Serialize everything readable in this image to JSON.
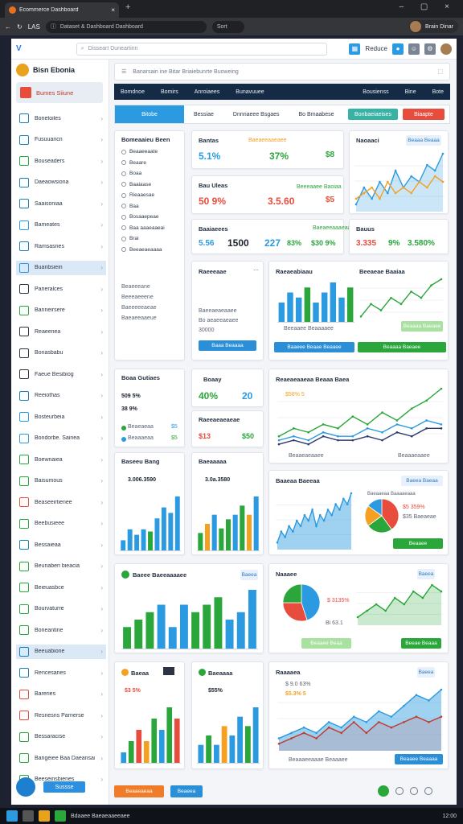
{
  "browser": {
    "tab_title": "Ecommerce Dashboard",
    "address": "Dataset & Dashboard Dashboard",
    "secondary_field": "Sort",
    "profile_name": "Brain Dinar",
    "back_label": "LAS"
  },
  "app": {
    "logo": "V",
    "search_placeholder": "Disseart Duneartinn",
    "top_right_label": "Reduce",
    "brand": "Bisn Ebonia",
    "workspace": "Bumes Siiune",
    "sidebar": [
      {
        "label": "Bonetoiles",
        "active": false
      },
      {
        "label": "Fusuuaricn",
        "active": false
      },
      {
        "label": "Bouseaders",
        "active": false
      },
      {
        "label": "Daeaowsiona",
        "active": false
      },
      {
        "label": "Saaisoniaa",
        "active": false
      },
      {
        "label": "Bameates",
        "active": false
      },
      {
        "label": "Ramsasries",
        "active": false
      },
      {
        "label": "Buanbsiein",
        "active": true
      },
      {
        "label": "Parieralces",
        "active": false
      },
      {
        "label": "Banneirsere",
        "active": false
      },
      {
        "label": "Reaeenea",
        "active": false
      },
      {
        "label": "Bonasbabu",
        "active": false
      },
      {
        "label": "Faeue Besibiog",
        "active": false
      },
      {
        "label": "Reeiothas",
        "active": false
      },
      {
        "label": "Bosteurbeia",
        "active": false
      },
      {
        "label": "Bondorbe. Sainea",
        "active": false
      },
      {
        "label": "Boewnaiea",
        "active": false
      },
      {
        "label": "Baisumous",
        "active": false
      },
      {
        "label": "Beaseeirtienee",
        "active": false
      },
      {
        "label": "Beebusieee",
        "active": false
      },
      {
        "label": "Bessaieaa",
        "active": false
      },
      {
        "label": "Beunaberi bieacia",
        "active": false
      },
      {
        "label": "Beieuasbce",
        "active": false
      },
      {
        "label": "Bourvaturre",
        "active": false
      },
      {
        "label": "Boneantine",
        "active": false
      },
      {
        "label": "Beeuabione",
        "active": true
      },
      {
        "label": "Rencesanes",
        "active": false
      },
      {
        "label": "Bareries",
        "active": false
      },
      {
        "label": "Resnesns Parrierse",
        "active": false
      },
      {
        "label": "Bessaracise",
        "active": false
      },
      {
        "label": "Bangeiee Baa Daeansanes",
        "active": false
      },
      {
        "label": "Beeseinsbienes",
        "active": false
      }
    ],
    "sidebar_button": "Sussse",
    "filter_text": "Banarsain ine Bitar Briaiebunrte Buoweing",
    "navbar": [
      "Bomdnoe",
      "Bomirs",
      "Anroiaees",
      "Bunavuuee"
    ],
    "navbar_right": [
      "Bousienss",
      "Bine",
      "Bote"
    ],
    "subbar": [
      "Bitobe",
      "Bessiae",
      "Dnnnaeee Bsgaes",
      "Bo Bmaabese"
    ],
    "subbar_btn1": "Bonbaeiaeises",
    "subbar_btn2": "Biaapte"
  },
  "cards": {
    "list": {
      "title": "Bomeaaieu Been",
      "items": [
        "Beaaeeaate",
        "Beaare",
        "Boaa",
        "Baaiaase",
        "Rieaaesae",
        "Baa",
        "Bosaaepeae",
        "Baa aaaeaaeai",
        "Brai",
        "Beeaeaeaaaa"
      ],
      "foot": [
        "Beaeeeane",
        "Beeeaeeene",
        "Baeeeeeaeae",
        "Baeaeeaaeue"
      ]
    },
    "kpi1": {
      "title": "Bantas",
      "a": "5.1%",
      "b": "37%",
      "c": "$8",
      "tag": "Baeaeeaaeaee"
    },
    "kpi2": {
      "title": "Bau Uleas",
      "a": "50 9%",
      "b": "3.5.60",
      "c": "$5",
      "tag": "Beeeaaee Baoiaa"
    },
    "kpi3": {
      "title": "Baaiaeees",
      "a": "5.56",
      "b": "1500",
      "c": "227",
      "d": "83%",
      "e": "$30 9%",
      "tag": "Baeaeeaaaeaa"
    },
    "kpi4": {
      "title": "Bauus",
      "a": "3.335",
      "b": "9%",
      "c": "3.580%"
    },
    "mini_chart": {
      "title": "Naoaaci",
      "tag": "Beaaa Beaaa"
    },
    "mid1": {
      "title": "Raeeeaae",
      "lines": [
        "Baeeaeaeaaee",
        "Bo aeaeeaeaee",
        "30000"
      ],
      "button": "Baaa Beaaaa"
    },
    "mid2": {
      "title": "Raeaeabiaau",
      "title2": "Beeaeae Baaiaa",
      "legend": "Beeaaee Beaaaaee",
      "button1": "Baaeee Beaae Beaaee",
      "button2": "Beaaaa Baeaee"
    },
    "pct": {
      "title": "Boaa Gutiaes",
      "a": "509 5%",
      "b": "38 9%",
      "rows": [
        [
          "Beaeaeaa",
          "$5"
        ],
        [
          "Beaaaeaa",
          "$5"
        ]
      ]
    },
    "mini": {
      "title": "Boaay",
      "a": "40%",
      "b": "20"
    },
    "mini2": {
      "title": "Raeeaeaeaeae",
      "a": "$13",
      "b": "$50"
    },
    "bigline": {
      "title": "Reaeaeaaeaa Beaaa Baea",
      "sub": "$58% 5",
      "legend": [
        "Beaaeaeaaee",
        "Beaaaeaaee"
      ]
    },
    "bar_a": {
      "title": "Baseeu Bang",
      "value": "3.006.3590"
    },
    "bar_b": {
      "title": "Baeaaaaa",
      "value": "3.0a.3580"
    },
    "area": {
      "title": "Baaeaa Baeeaa",
      "tag": "Baeea Baeaa"
    },
    "pie1": {
      "title": "Baeaaeaa Baaaaeaaa",
      "a": "$5 359%",
      "b": "$35 Baeaeae",
      "button": "Beaaee"
    },
    "bigbar": {
      "title": "Baeee Baeeaaaaee",
      "tag": "Baeea"
    },
    "pie2": {
      "title": "Naaaee",
      "a": "$ 3135%",
      "b": "Bi 63.1",
      "tag": "Baeea",
      "btn1": "Beaaee Beaa",
      "btn2": "Beeae Beaaa"
    },
    "s1": {
      "title": "Baeaa",
      "a": "$3 5%"
    },
    "s2": {
      "title": "Baeaaaa",
      "a": "$55%"
    },
    "wide": {
      "title": "Raaaaea",
      "a": "$5.3% 5",
      "b": "$ 9.0 63%",
      "legend": "Beaaaeeaaae Beaaaee",
      "tag": "Baeea",
      "btn": "Beaaee Beaaaa"
    }
  },
  "footer": {
    "btn1": "Beaaeaeaa",
    "btn2": "Beaeea"
  },
  "taskbar": {
    "app": "Bdaaee Baeaeaaeeaee",
    "time": "12:00"
  },
  "colors": {
    "blue": "#2b9ae0",
    "green": "#2aa63a",
    "orange": "#f4a123",
    "red": "#e74c3c",
    "navy": "#152a45"
  },
  "chart_data": [
    {
      "type": "line",
      "id": "mini",
      "x": [
        1,
        2,
        3,
        4,
        5,
        6,
        7,
        8,
        9,
        10,
        11,
        12
      ],
      "series": [
        {
          "values": [
            3,
            6,
            4,
            7,
            5,
            9,
            6,
            8,
            7,
            10,
            9,
            12
          ]
        },
        {
          "values": [
            4,
            5,
            6,
            4,
            7,
            5,
            6,
            5,
            7,
            6,
            8,
            7
          ]
        }
      ]
    },
    {
      "type": "bar",
      "id": "mid2",
      "values": [
        4,
        6,
        5,
        7,
        4,
        6,
        8,
        5,
        7
      ]
    },
    {
      "type": "line",
      "id": "mid2line",
      "values": [
        2,
        4,
        3,
        5,
        4,
        6,
        5,
        7,
        8
      ]
    },
    {
      "type": "line",
      "id": "bigline",
      "series": [
        {
          "values": [
            3,
            5,
            4,
            6,
            5,
            8,
            6,
            9,
            7,
            10,
            12,
            15
          ]
        },
        {
          "values": [
            2,
            3,
            2,
            4,
            3,
            3,
            5,
            4,
            6,
            5,
            7,
            6
          ]
        },
        {
          "values": [
            1,
            2,
            1,
            3,
            2,
            2,
            3,
            2,
            4,
            3,
            5,
            5
          ]
        }
      ]
    },
    {
      "type": "bar",
      "id": "bar_a",
      "values": [
        1,
        2,
        1.5,
        2,
        1.8,
        3,
        4,
        3.5,
        5
      ]
    },
    {
      "type": "bar",
      "id": "bar_b",
      "values": [
        2,
        3,
        4,
        2.5,
        3.5,
        4,
        5,
        4,
        6
      ]
    },
    {
      "type": "area",
      "id": "area",
      "values": [
        3,
        5,
        4,
        6,
        5,
        7,
        6,
        8,
        7,
        9,
        6,
        8,
        7,
        9,
        8,
        10,
        9,
        11,
        10,
        12
      ]
    },
    {
      "type": "pie",
      "id": "pie1",
      "values": [
        40,
        25,
        20,
        15
      ]
    },
    {
      "type": "bar",
      "id": "bigbar",
      "values": [
        3,
        4,
        5,
        6,
        3,
        6,
        5,
        6,
        7,
        4,
        5,
        8
      ]
    },
    {
      "type": "pie",
      "id": "pie2",
      "values": [
        45,
        30,
        25
      ]
    },
    {
      "type": "bar",
      "id": "s1",
      "values": [
        1,
        2,
        3,
        2,
        4,
        3,
        5,
        4
      ]
    },
    {
      "type": "bar",
      "id": "s2",
      "values": [
        2,
        3,
        2,
        4,
        3,
        5,
        4,
        6
      ]
    },
    {
      "type": "area",
      "id": "wide",
      "series": [
        {
          "values": [
            2,
            3,
            4,
            3,
            5,
            4,
            6,
            5,
            7,
            6,
            8,
            10,
            9,
            11
          ]
        },
        {
          "values": [
            1,
            2,
            3,
            2,
            4,
            3,
            5,
            3,
            5,
            4,
            5,
            6,
            5,
            6
          ]
        }
      ]
    }
  ]
}
